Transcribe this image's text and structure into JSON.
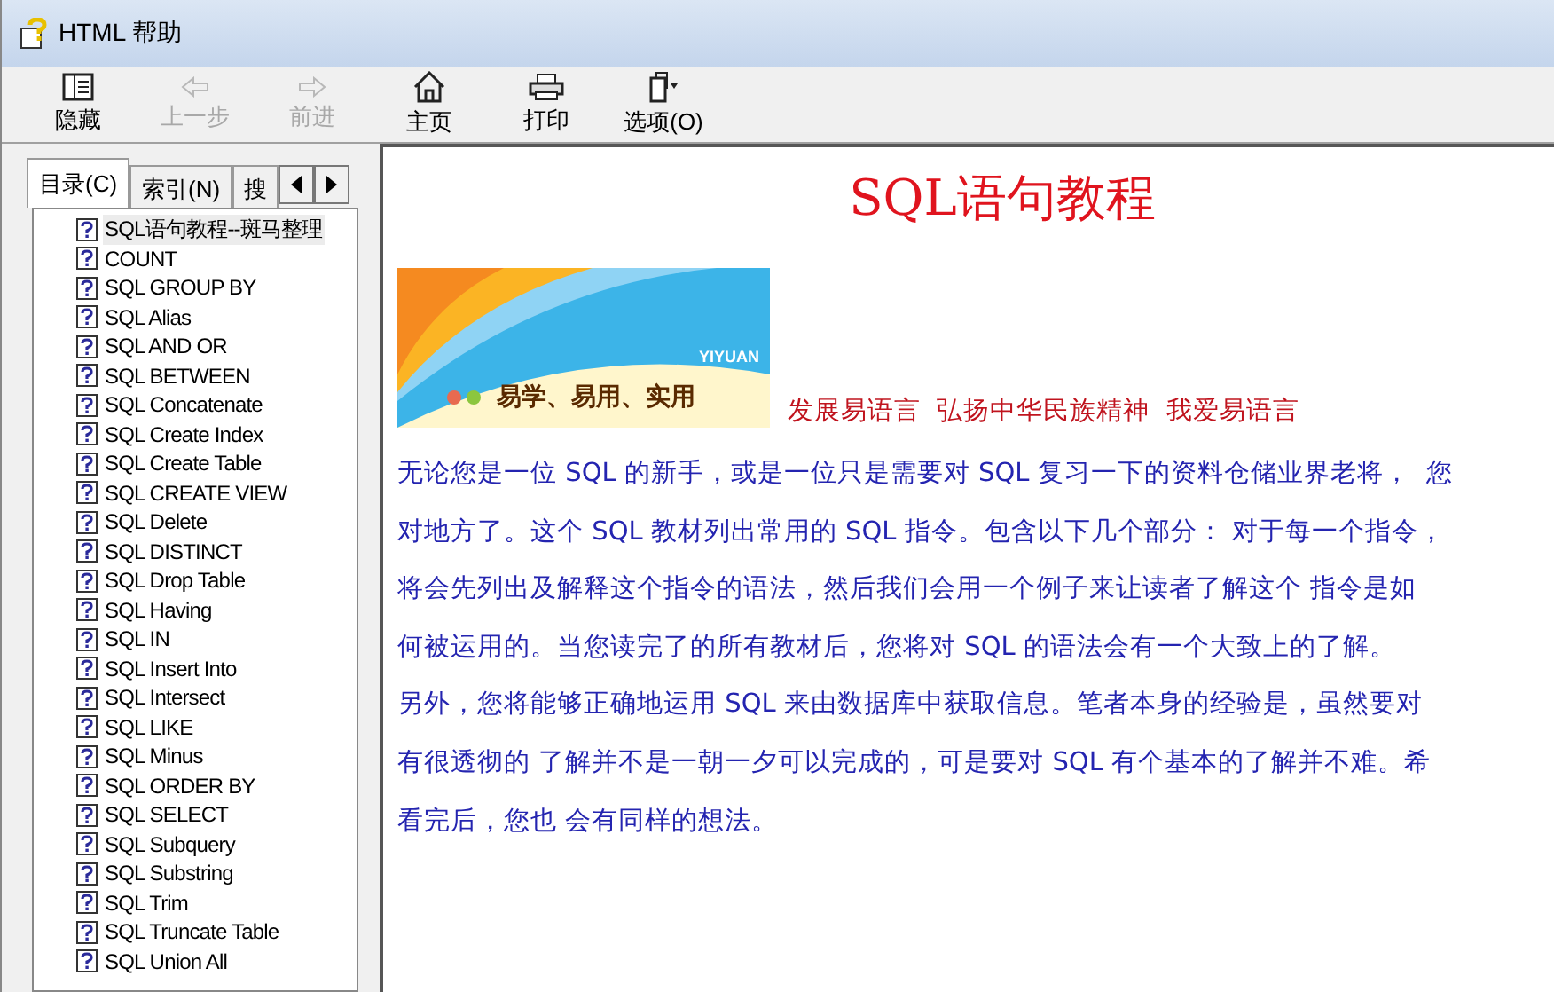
{
  "window": {
    "title": "HTML 帮助"
  },
  "toolbar": [
    {
      "label": "隐藏",
      "kind": "hide",
      "disabled": false
    },
    {
      "label": "上一步",
      "kind": "back",
      "disabled": true
    },
    {
      "label": "前进",
      "kind": "forward",
      "disabled": true
    },
    {
      "label": "主页",
      "kind": "home",
      "disabled": false
    },
    {
      "label": "打印",
      "kind": "print",
      "disabled": false
    },
    {
      "label": "选项(O)",
      "kind": "options",
      "disabled": false
    }
  ],
  "tabs": [
    {
      "label": "目录(C)",
      "selected": true
    },
    {
      "label": "索引(N)",
      "selected": false
    },
    {
      "label": "搜",
      "selected": false
    }
  ],
  "tree": {
    "items": [
      {
        "label": "SQL语句教程--斑马整理",
        "selected": true
      },
      {
        "label": "COUNT",
        "selected": false
      },
      {
        "label": "SQL GROUP BY",
        "selected": false
      },
      {
        "label": "SQL Alias",
        "selected": false
      },
      {
        "label": "SQL AND OR",
        "selected": false
      },
      {
        "label": "SQL BETWEEN",
        "selected": false
      },
      {
        "label": "SQL Concatenate",
        "selected": false
      },
      {
        "label": "SQL Create Index",
        "selected": false
      },
      {
        "label": "SQL Create Table",
        "selected": false
      },
      {
        "label": "SQL CREATE VIEW",
        "selected": false
      },
      {
        "label": "SQL Delete",
        "selected": false
      },
      {
        "label": "SQL DISTINCT",
        "selected": false
      },
      {
        "label": "SQL Drop Table",
        "selected": false
      },
      {
        "label": "SQL Having",
        "selected": false
      },
      {
        "label": "SQL IN",
        "selected": false
      },
      {
        "label": "SQL Insert Into",
        "selected": false
      },
      {
        "label": "SQL Intersect",
        "selected": false
      },
      {
        "label": "SQL LIKE",
        "selected": false
      },
      {
        "label": "SQL Minus",
        "selected": false
      },
      {
        "label": "SQL ORDER BY",
        "selected": false
      },
      {
        "label": "SQL SELECT",
        "selected": false
      },
      {
        "label": "SQL Subquery",
        "selected": false
      },
      {
        "label": "SQL Substring",
        "selected": false
      },
      {
        "label": "SQL Trim",
        "selected": false
      },
      {
        "label": "SQL Truncate Table",
        "selected": false
      },
      {
        "label": "SQL Union All",
        "selected": false
      }
    ]
  },
  "content": {
    "heading": "SQL语句教程",
    "banner": {
      "brand": "YIYUAN",
      "slogan": "易学、易用、实用"
    },
    "tagline": "发展易语言  弘扬中华民族精神  我爱易语言",
    "lines": [
      "无论您是一位 SQL 的新手，或是一位只是需要对 SQL 复习一下的资料仓储业界老将，  您",
      "对地方了。这个 SQL 教材列出常用的 SQL 指令。包含以下几个部分： 对于每一个指令，",
      "将会先列出及解释这个指令的语法，然后我们会用一个例子来让读者了解这个 指令是如",
      "何被运用的。当您读完了的所有教材后，您将对 SQL 的语法会有一个大致上的了解。",
      "另外，您将能够正确地运用 SQL 来由数据库中获取信息。笔者本身的经验是，虽然要对",
      "有很透彻的 了解并不是一朝一夕可以完成的，可是要对 SQL 有个基本的了解并不难。希",
      "看完后，您也 会有同样的想法。"
    ]
  }
}
